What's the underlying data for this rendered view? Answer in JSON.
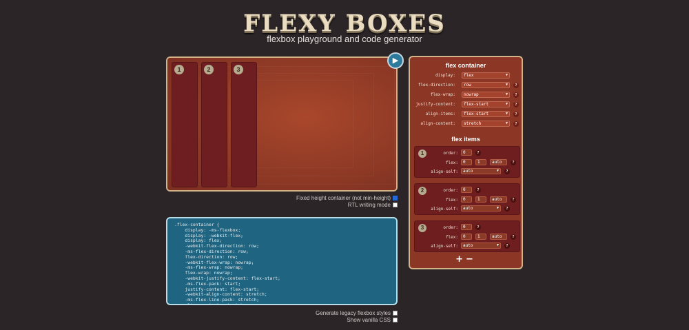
{
  "header": {
    "title": "FLEXY BOXES",
    "subtitle": "flexbox playground and code generator"
  },
  "playground": {
    "items": [
      {
        "number": "1"
      },
      {
        "number": "2"
      },
      {
        "number": "3"
      }
    ],
    "run_icon": "play-arrow"
  },
  "options": {
    "fixed_height": {
      "label": "Fixed height container (not min-height)",
      "checked": true
    },
    "rtl": {
      "label": "RTL writing mode",
      "checked": false
    },
    "legacy": {
      "label": "Generate legacy flexbox styles",
      "checked": false
    },
    "vanilla": {
      "label": "Show vanilla CSS",
      "checked": false
    }
  },
  "code": {
    "text": ".flex-container {\n    display: -ms-flexbox;\n    display: -webkit-flex;\n    display: flex;\n    -webkit-flex-direction: row;\n    -ms-flex-direction: row;\n    flex-direction: row;\n    -webkit-flex-wrap: nowrap;\n    -ms-flex-wrap: nowrap;\n    flex-wrap: nowrap;\n    -webkit-justify-content: flex-start;\n    -ms-flex-pack: start;\n    justify-content: flex-start;\n    -webkit-align-content: stretch;\n    -ms-flex-line-pack: stretch;\n    align-content: stretch;"
  },
  "panel": {
    "container_title": "flex container",
    "container_props": [
      {
        "label": "display:",
        "value": "flex"
      },
      {
        "label": "flex-direction:",
        "value": "row"
      },
      {
        "label": "flex-wrap:",
        "value": "nowrap"
      },
      {
        "label": "justify-content:",
        "value": "flex-start"
      },
      {
        "label": "align-items:",
        "value": "flex-start"
      },
      {
        "label": "align-content:",
        "value": "stretch"
      }
    ],
    "items_title": "flex items",
    "labels": {
      "order": "order:",
      "flex": "flex:",
      "align_self": "align-self:"
    },
    "items": [
      {
        "number": "1",
        "order": "0",
        "grow": "0",
        "shrink": "1",
        "basis": "auto",
        "align_self": "auto"
      },
      {
        "number": "2",
        "order": "0",
        "grow": "0",
        "shrink": "1",
        "basis": "auto",
        "align_self": "auto"
      },
      {
        "number": "3",
        "order": "0",
        "grow": "0",
        "shrink": "1",
        "basis": "auto",
        "align_self": "auto"
      }
    ],
    "help": "?",
    "add_label": "+",
    "remove_label": "−"
  }
}
